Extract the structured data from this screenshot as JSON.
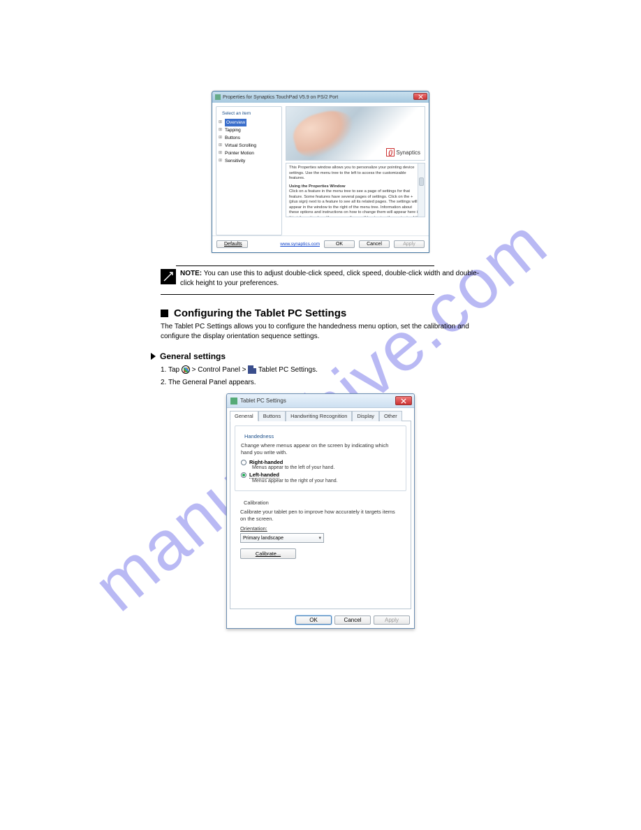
{
  "watermark": "manualshive.com",
  "synaptics": {
    "title": "Properties for Synaptics TouchPad V5.9 on PS/2 Port",
    "group_label": "Select an item",
    "tree": [
      "Overview",
      "Tapping",
      "Buttons",
      "Virtual Scrolling",
      "Pointer Motion",
      "Sensitivity"
    ],
    "logo_text": "Synaptics",
    "info_p1": "This Properties window allows you to personalize your pointing device settings. Use the menu tree to the left to access the customizable features.",
    "info_h": "Using the Properties Window",
    "info_p2": "Click on a feature in the menu tree to see a page of settings for that feature. Some features have several pages of settings. Click on the + (plus sign) next to a feature to see all its related pages. The settings will appear in the window to the right of the menu tree. Information about these options and instructions on how to change them will appear here in this information box. You can use the scroll bar to view the contents of the information box.",
    "link": "www.synaptics.com",
    "btn_defaults": "Defaults",
    "btn_ok": "OK",
    "btn_cancel": "Cancel",
    "btn_apply": "Apply"
  },
  "note": {
    "heading": "NOTE:",
    "text": "You can use this to adjust double-click speed, click speed, double-click width and double-click height to your preferences."
  },
  "sect": {
    "title": "Configuring the Tablet PC Settings",
    "body": "The Tablet PC Settings allows you to configure the handedness menu option, set the calibration and configure the display orientation sequence settings."
  },
  "sub": {
    "title": "General settings",
    "step1_pre": "1. Tap ",
    "step1_mid": " > Control Panel > ",
    "step1_end": " Tablet PC Settings.",
    "step2": "2. The General Panel appears."
  },
  "tablet": {
    "title": "Tablet PC Settings",
    "tabs": [
      "General",
      "Buttons",
      "Handwriting Recognition",
      "Display",
      "Other"
    ],
    "grp_handed": "Handedness",
    "handed_text": "Change where menus appear on the screen by indicating which hand you write with.",
    "r1": "Right-handed",
    "r1_sub": "Menus appear to the left of your hand.",
    "r2": "Left-handed",
    "r2_sub": "Menus appear to the right of your hand.",
    "grp_calib": "Calibration",
    "calib_text": "Calibrate your tablet pen to improve how accurately it targets items on the screen.",
    "orient_label": "Orientation:",
    "orient_value": "Primary landscape",
    "calib_btn": "Calibrate...",
    "btn_ok": "OK",
    "btn_cancel": "Cancel",
    "btn_apply": "Apply"
  }
}
